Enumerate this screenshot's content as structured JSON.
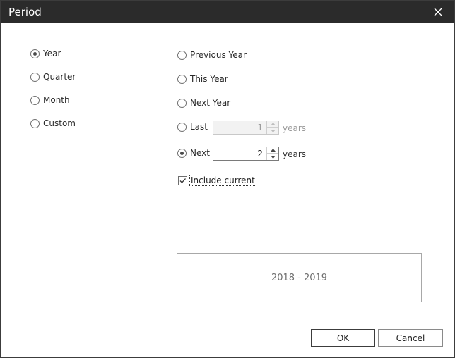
{
  "dialog": {
    "title": "Period"
  },
  "period_types": [
    {
      "label": "Year",
      "checked": true
    },
    {
      "label": "Quarter",
      "checked": false
    },
    {
      "label": "Month",
      "checked": false
    },
    {
      "label": "Custom",
      "checked": false
    }
  ],
  "year_options": {
    "previous_year": "Previous Year",
    "this_year": "This Year",
    "next_year": "Next Year",
    "last": {
      "label": "Last",
      "value": "1",
      "unit": "years",
      "enabled": false
    },
    "next": {
      "label": "Next",
      "value": "2",
      "unit": "years",
      "enabled": true,
      "checked": true
    },
    "include_current": {
      "label": "Include current",
      "checked": true
    }
  },
  "result": "2018 - 2019",
  "buttons": {
    "ok": "OK",
    "cancel": "Cancel"
  }
}
